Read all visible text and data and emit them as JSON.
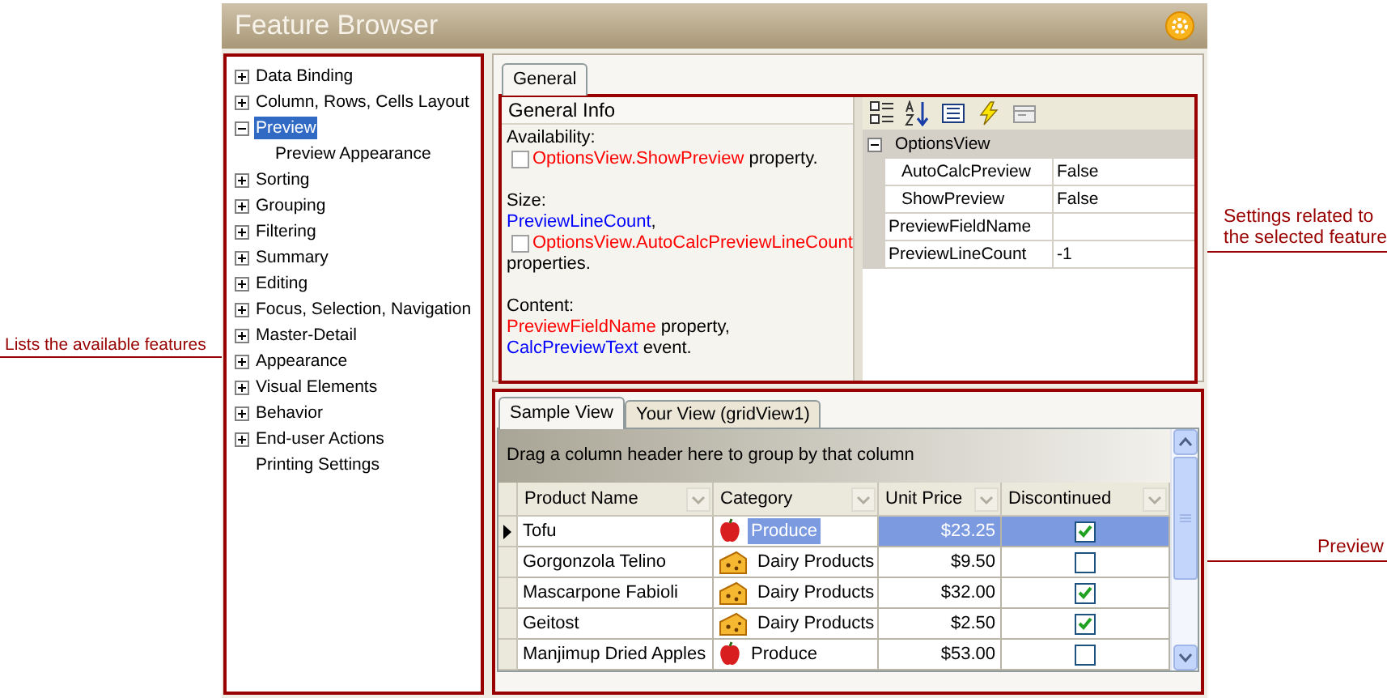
{
  "window": {
    "title": "Feature Browser"
  },
  "tree": [
    {
      "label": "Data Binding",
      "kind": "group",
      "expanded": false,
      "selected": false
    },
    {
      "label": "Column, Rows, Cells Layout",
      "kind": "group",
      "expanded": false,
      "selected": false
    },
    {
      "label": "Preview",
      "kind": "group",
      "expanded": true,
      "selected": true,
      "children": [
        {
          "label": "Preview Appearance",
          "kind": "leaf",
          "selected": false
        }
      ]
    },
    {
      "label": "Sorting",
      "kind": "group",
      "expanded": false,
      "selected": false
    },
    {
      "label": "Grouping",
      "kind": "group",
      "expanded": false,
      "selected": false
    },
    {
      "label": "Filtering",
      "kind": "group",
      "expanded": false,
      "selected": false
    },
    {
      "label": "Summary",
      "kind": "group",
      "expanded": false,
      "selected": false
    },
    {
      "label": "Editing",
      "kind": "group",
      "expanded": false,
      "selected": false
    },
    {
      "label": "Focus, Selection, Navigation",
      "kind": "group",
      "expanded": false,
      "selected": false
    },
    {
      "label": "Master-Detail",
      "kind": "group",
      "expanded": false,
      "selected": false
    },
    {
      "label": "Appearance",
      "kind": "group",
      "expanded": false,
      "selected": false
    },
    {
      "label": "Visual Elements",
      "kind": "group",
      "expanded": false,
      "selected": false
    },
    {
      "label": "Behavior",
      "kind": "group",
      "expanded": false,
      "selected": false
    },
    {
      "label": "End-user Actions",
      "kind": "group",
      "expanded": false,
      "selected": false
    },
    {
      "label": "Printing Settings",
      "kind": "leaf",
      "selected": false
    }
  ],
  "top_tabs": [
    {
      "label": "General",
      "selected": true
    }
  ],
  "general_info": {
    "title": "General Info",
    "sections": [
      {
        "heading": "Availability:",
        "lines": [
          {
            "checked": false,
            "parts": [
              {
                "text": "OptionsView.ShowPreview",
                "kind": "link",
                "color": "#ff0000"
              },
              {
                "text": " property.",
                "kind": "plain"
              }
            ]
          }
        ]
      },
      {
        "heading": "Size:",
        "lines": [
          {
            "parts": [
              {
                "text": "PreviewLineCount",
                "kind": "link",
                "color": "#0000ff"
              },
              {
                "text": ",",
                "kind": "plain"
              }
            ]
          },
          {
            "checked": false,
            "parts": [
              {
                "text": "OptionsView.AutoCalcPreviewLineCount",
                "kind": "link",
                "color": "#ff0000"
              }
            ]
          },
          {
            "parts": [
              {
                "text": "properties.",
                "kind": "plain"
              }
            ]
          }
        ]
      },
      {
        "heading": "Content:",
        "lines": [
          {
            "parts": [
              {
                "text": "PreviewFieldName",
                "kind": "link",
                "color": "#ff0000"
              },
              {
                "text": " property,",
                "kind": "plain"
              }
            ]
          },
          {
            "parts": [
              {
                "text": "CalcPreviewText",
                "kind": "link",
                "color": "#0000ff"
              },
              {
                "text": " event.",
                "kind": "plain"
              }
            ]
          }
        ]
      }
    ]
  },
  "property_grid": {
    "rows": [
      {
        "name": "OptionsView",
        "kind": "category",
        "expanded": true,
        "children": [
          {
            "name": "AutoCalcPreview",
            "value": "False",
            "kind": "property"
          },
          {
            "name": "ShowPreview",
            "value": "False",
            "kind": "property"
          }
        ]
      },
      {
        "name": "PreviewFieldName",
        "kind": "property"
      },
      {
        "name": "PreviewLineCount",
        "value": "-1",
        "kind": "property"
      }
    ]
  },
  "bottom_tabs": [
    {
      "label": "Sample View",
      "selected": true
    },
    {
      "label": "Your View (gridView1)",
      "selected": false
    }
  ],
  "grid": {
    "group_panel": "Drag a column header here to group by that column",
    "columns": [
      "Product Name",
      "Category",
      "Unit Price",
      "Discontinued"
    ],
    "rows": [
      {
        "selected": true,
        "name": "Tofu",
        "category": {
          "text": "Produce",
          "kind": "apple"
        },
        "price": "$23.25",
        "discontinued": true
      },
      {
        "selected": false,
        "name": "Gorgonzola Telino",
        "category": {
          "text": "Dairy Products",
          "kind": "cheese"
        },
        "price": "$9.50",
        "discontinued": false
      },
      {
        "selected": false,
        "name": "Mascarpone Fabioli",
        "category": {
          "text": "Dairy Products",
          "kind": "cheese"
        },
        "price": "$32.00",
        "discontinued": true
      },
      {
        "selected": false,
        "name": "Geitost",
        "category": {
          "text": "Dairy Products",
          "kind": "cheese"
        },
        "price": "$2.50",
        "discontinued": true
      },
      {
        "selected": false,
        "name": "Manjimup Dried Apples",
        "category": {
          "text": "Produce",
          "kind": "apple"
        },
        "price": "$53.00",
        "discontinued": false
      }
    ]
  },
  "annotations": {
    "left": "Lists the available features",
    "right_top": "Settings related to\nthe selected feature",
    "right_bottom": "Preview"
  }
}
